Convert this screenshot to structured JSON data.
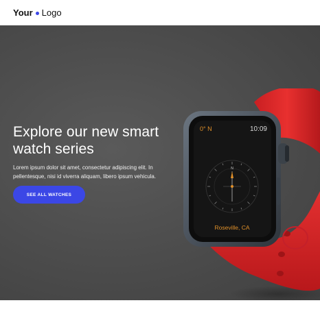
{
  "header": {
    "logo_bold": "Your",
    "logo_light": "Logo"
  },
  "hero": {
    "title": "Explore our new smart watch series",
    "description": "Lorem ipsum dolor sit amet, consectetur adipiscing elit. In pellentesque, nisi id viverra aliquam, libero ipsum vehicula.",
    "cta_label": "SEE ALL WATCHES"
  },
  "watch_face": {
    "temperature": "0° N",
    "time": "10:09",
    "location": "Roseville, CA",
    "compass_north": "N"
  },
  "colors": {
    "accent": "#3b47e6",
    "band": "#e8302f",
    "hero_bg": "#4e4e4e",
    "watch_text": "#e0902a"
  }
}
